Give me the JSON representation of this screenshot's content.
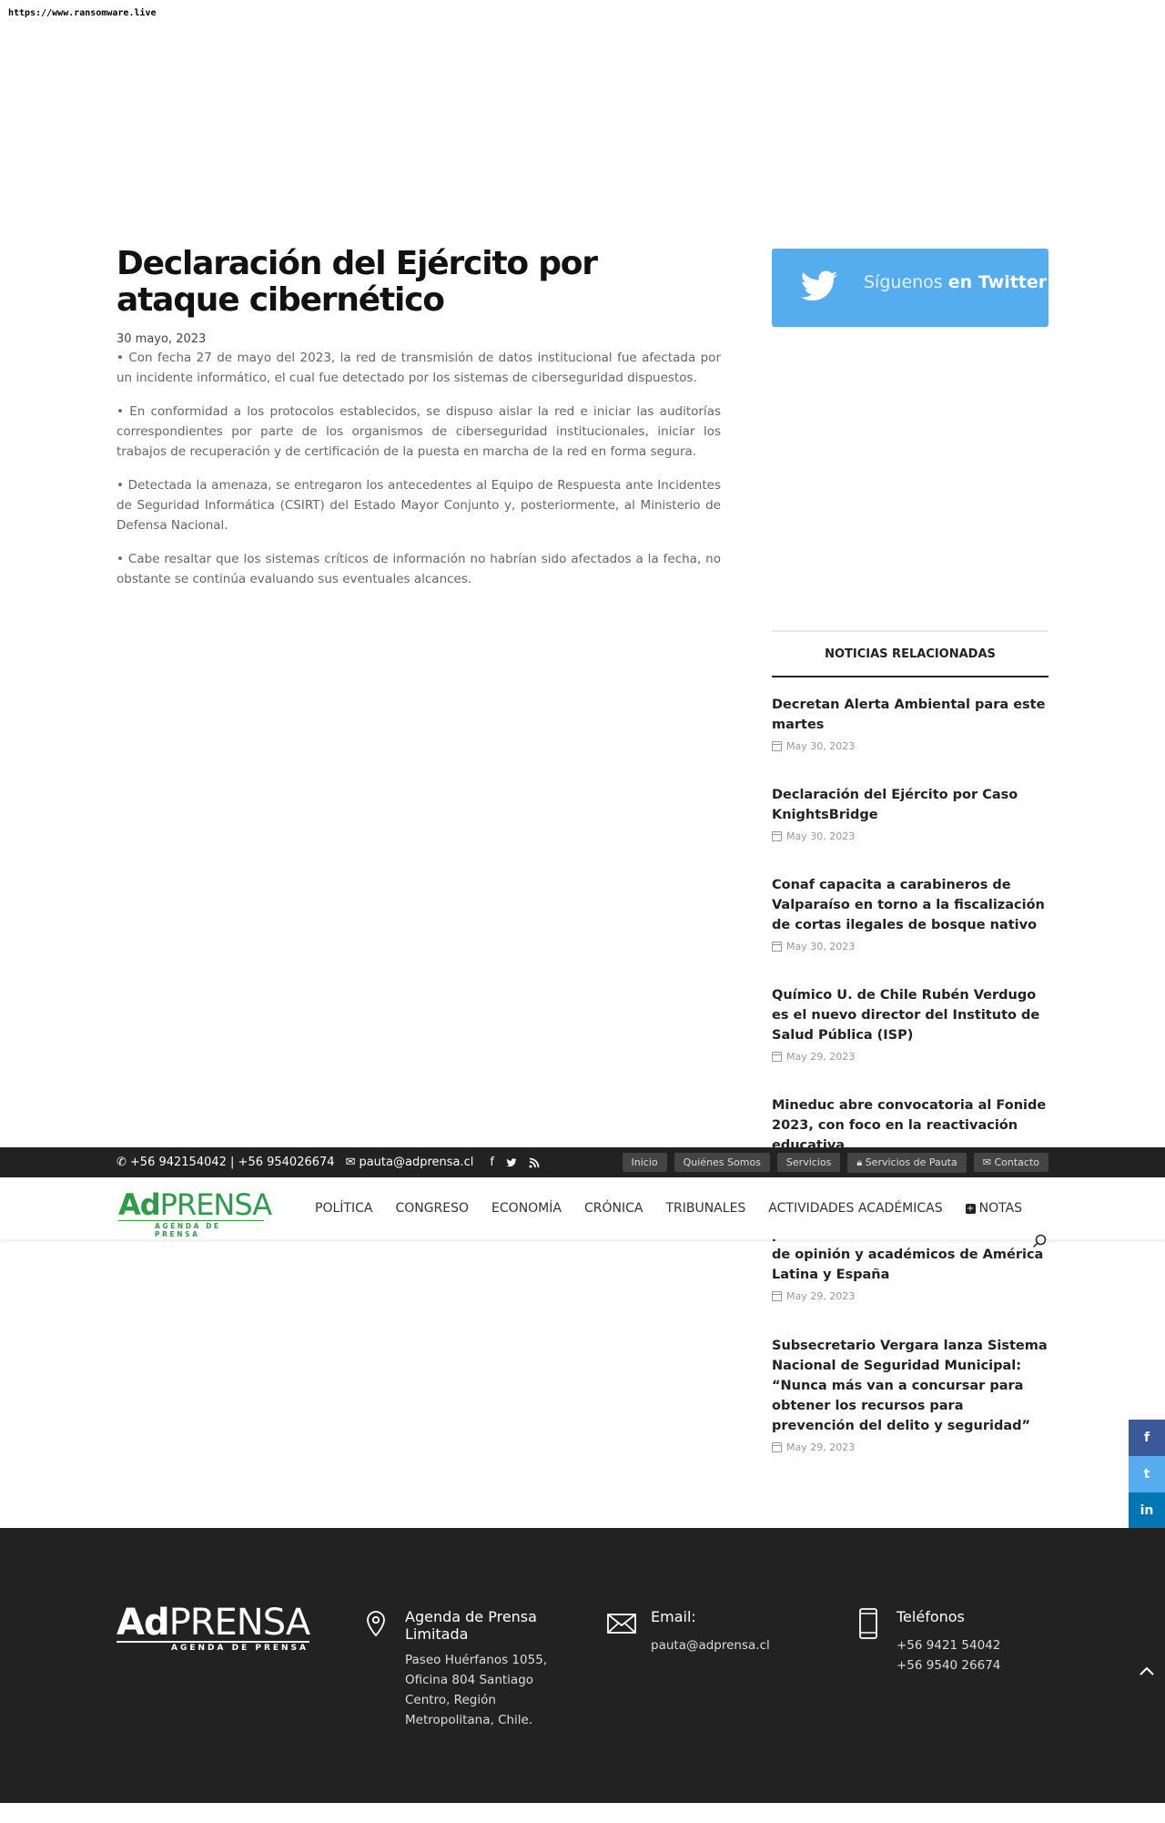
{
  "url_label": "https://www.ransomware.live",
  "article": {
    "title": "Declaración del Ejército por ataque cibernético",
    "date": "30 mayo, 2023",
    "paragraphs": [
      "• Con fecha 27 de mayo del 2023, la red de transmisión de datos institucional fue afectada por un incidente informático, el cual fue detectado por los sistemas de ciberseguridad dispuestos.",
      "• En conformidad a los protocolos establecidos, se dispuso aislar la red e iniciar las auditorías correspondientes por parte de los organismos de ciberseguridad institucionales, iniciar los trabajos de recuperación y de certificación de la puesta en marcha de la red en forma segura.",
      "• Detectada la amenaza, se entregaron los antecedentes al Equipo de Respuesta ante Incidentes de Seguridad Informática (CSIRT) del Estado Mayor Conjunto y, posteriormente, al Ministerio de Defensa Nacional.",
      "• Cabe resaltar que los sistemas críticos de información no habrían sido afectados a la fecha, no obstante se continúa evaluando sus eventuales alcances."
    ]
  },
  "twitter": {
    "prefix": "Síguenos",
    "suffix": "en Twitter"
  },
  "related": {
    "heading": "NOTICIAS RELACIONADAS",
    "items": [
      {
        "title": "Decretan Alerta Ambiental para este martes",
        "date": "May 30, 2023"
      },
      {
        "title": "Declaración del Ejército por Caso KnightsBridge",
        "date": "May 30, 2023"
      },
      {
        "title": "Conaf capacita a carabineros de Valparaíso en torno a la fiscalización de cortas ilegales de bosque nativo",
        "date": "May 30, 2023"
      },
      {
        "title": "Químico U. de Chile Rubén Verdugo es el nuevo director del Instituto de Salud Pública (ISP)",
        "date": "May 29, 2023"
      },
      {
        "title": "Mineduc abre convocatoria al Fonide 2023, con foco en la reactivación educativa",
        "date": ""
      },
      {
        "title": "primer encuentro masivo de líderes de opinión y académicos de América Latina y España",
        "date": "May 29, 2023"
      },
      {
        "title": "Subsecretario Vergara lanza Sistema Nacional de Seguridad Municipal: “Nunca más van a concursar para obtener los recursos para prevención del delito y seguridad”",
        "date": "May 29, 2023"
      }
    ]
  },
  "topbar": {
    "phones": "+56 942154042 | +56 954026674",
    "email": "pauta@adprensa.cl",
    "buttons": [
      "Inicio",
      "Quiénes Somos",
      "Servicios",
      "Servicios de Pauta",
      "Contacto"
    ]
  },
  "logo": {
    "ad": "Ad",
    "prensa": "PRENSA",
    "sub": "AGENDA DE PRENSA"
  },
  "nav": [
    "POLÍTICA",
    "CONGRESO",
    "ECONOMÍA",
    "CRÓNICA",
    "TRIBUNALES",
    "ACTIVIDADES ACADÉMICAS",
    "NOTAS"
  ],
  "share": [
    "f",
    "t",
    "in"
  ],
  "colors": {
    "twitter": "#55acee",
    "facebook": "#3b5998",
    "linkedin": "#0077b5",
    "brand_green": "#2e9b49",
    "footer_bg": "#222222"
  },
  "footer": {
    "address_title": "Agenda de Prensa Limitada",
    "address": "Paseo Huérfanos 1055, Oficina 804 Santiago Centro, Región Metropolitana, Chile.",
    "email_title": "Email:",
    "email": "pauta@adprensa.cl",
    "phones_title": "Teléfonos",
    "phone1": "+56 9421 54042",
    "phone2": "+56 9540 26674"
  }
}
